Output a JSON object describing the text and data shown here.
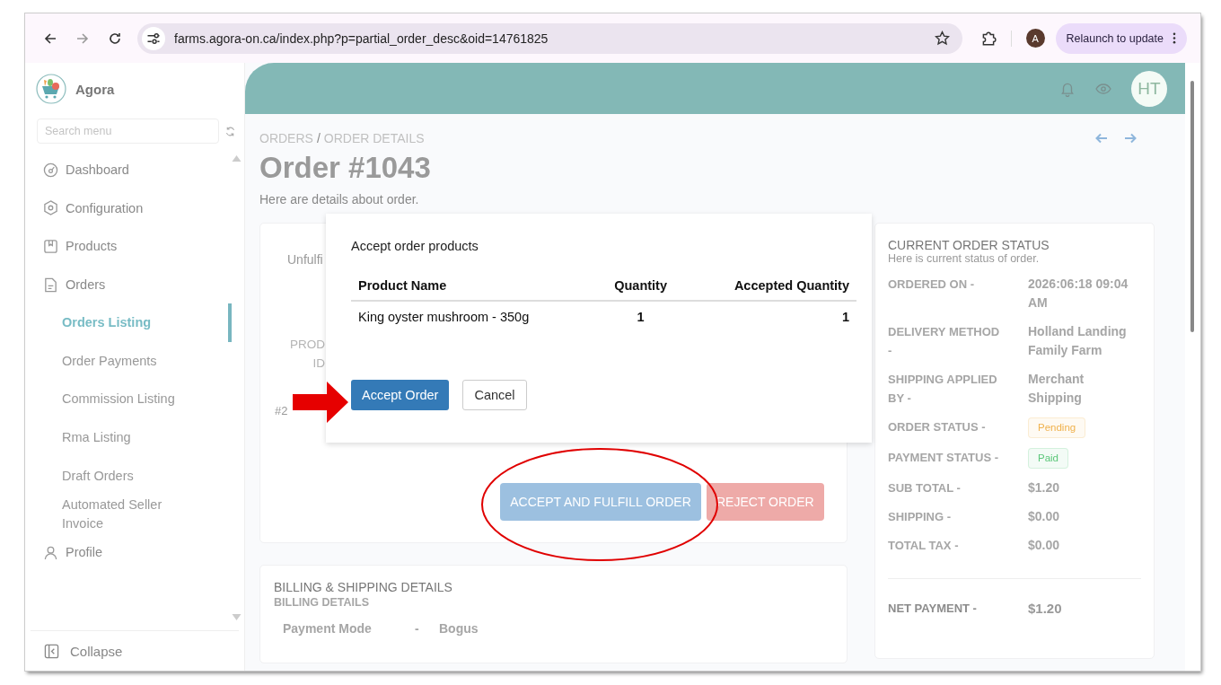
{
  "browser": {
    "url": "farms.agora-on.ca/index.php?p=partial_order_desc&oid=14761825",
    "profile_initial": "A",
    "relaunch": "Relaunch to update"
  },
  "sidebar": {
    "brand": "Agora",
    "search": {
      "placeholder": "Search menu"
    },
    "items": [
      {
        "label": "Dashboard",
        "selected": false
      },
      {
        "label": "Configuration",
        "selected": false
      },
      {
        "label": "Products",
        "selected": false
      },
      {
        "label": "Orders",
        "selected": false,
        "children": [
          {
            "label": "Orders Listing",
            "selected": true
          },
          {
            "label": "Order Payments",
            "selected": false
          },
          {
            "label": "Commission Listing",
            "selected": false
          },
          {
            "label": "Rma Listing",
            "selected": false
          },
          {
            "label": "Draft Orders",
            "selected": false
          },
          {
            "label": "Automated Seller Invoice",
            "selected": false
          }
        ]
      },
      {
        "label": "Profile",
        "selected": false
      }
    ],
    "collapse": "Collapse"
  },
  "header": {
    "avatar": "HT"
  },
  "breadcrumb": {
    "items": [
      "ORDERS",
      "ORDER DETAILS"
    ],
    "separator": "/"
  },
  "title": "Order #1043",
  "subtitle": "Here are details about order.",
  "order_card": {
    "status_text": "Unfulfi",
    "column_1": [
      "PROD",
      "ID"
    ],
    "cell": "#2",
    "buttons": [
      {
        "label": "ACCEPT AND FULFILL ORDER",
        "kind": "primary"
      },
      {
        "label": "REJECT ORDER",
        "kind": "danger"
      }
    ]
  },
  "billing": {
    "title": "BILLING & SHIPPING DETAILS",
    "subtitle": "BILLING DETAILS",
    "rows": [
      {
        "label": "Payment Mode",
        "sep": "-",
        "value": "Bogus"
      }
    ]
  },
  "status_card": {
    "title": "CURRENT ORDER STATUS",
    "subtitle": "Here is current status of order.",
    "rows": [
      {
        "kind": "text",
        "label": "ORDERED ON -",
        "value": "2026:06:18 09:04 AM"
      },
      {
        "kind": "text",
        "label": "DELIVERY METHOD -",
        "value": "Holland Landing Family Farm"
      },
      {
        "kind": "text",
        "label": "SHIPPING APPLIED BY -",
        "value": "Merchant Shipping"
      },
      {
        "kind": "badge",
        "label": "ORDER STATUS -",
        "value": "Pending",
        "color": "#f0b24e"
      },
      {
        "kind": "badge",
        "label": "PAYMENT STATUS -",
        "value": "Paid",
        "color": "#5cc77a"
      },
      {
        "kind": "text",
        "label": "SUB TOTAL -",
        "value": "$1.20"
      },
      {
        "kind": "text",
        "label": "SHIPPING -",
        "value": "$0.00"
      },
      {
        "kind": "text",
        "label": "TOTAL TAX -",
        "value": "$0.00"
      },
      {
        "kind": "total",
        "label": "NET PAYMENT -",
        "value": "$1.20"
      }
    ]
  },
  "modal": {
    "title": "Accept order products",
    "columns": [
      "Product Name",
      "Quantity",
      "Accepted Quantity"
    ],
    "rows": [
      {
        "name": "King oyster mushroom - 350g",
        "quantity": "1",
        "accepted": "1"
      }
    ],
    "buttons": [
      {
        "label": "Accept Order",
        "kind": "primary"
      },
      {
        "label": "Cancel",
        "kind": "secondary"
      }
    ]
  }
}
